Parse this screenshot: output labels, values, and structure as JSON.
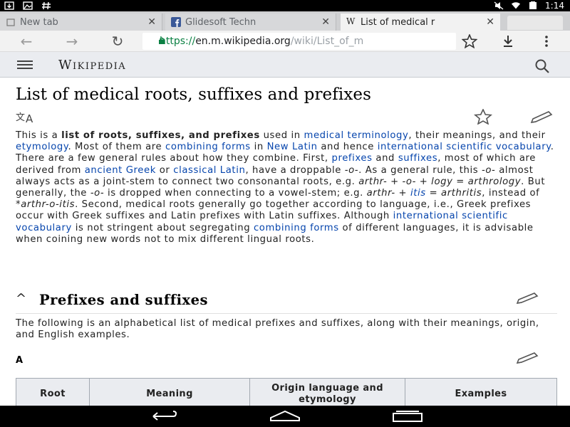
{
  "status_bar": {
    "time": "1:14",
    "icons_left": [
      "download-icon",
      "photo-icon",
      "hash-icon"
    ],
    "icons_right": [
      "mute-icon",
      "wifi-icon",
      "battery-icon"
    ]
  },
  "tabs": [
    {
      "label": "New tab",
      "favicon": "chrome-icon"
    },
    {
      "label": "Glidesoft Techn",
      "favicon": "facebook-icon"
    },
    {
      "label": "List of medical r",
      "favicon": "wikipedia-icon",
      "active": true
    }
  ],
  "toolbar": {
    "url_protocol": "https://",
    "url_host": "en.m.wikipedia.org",
    "url_path": "/wiki/List_of_m"
  },
  "wiki": {
    "logo_text": "Wikipedia"
  },
  "article": {
    "title": "List of medical roots, suffixes and prefixes",
    "intro": {
      "p1": "This is a ",
      "bold1": "list of roots, suffixes, and prefixes",
      "p2": " used in ",
      "link_medical_terminology": "medical terminology",
      "p3": ", their meanings, and their ",
      "link_etymology": "etymology",
      "p4": ". Most of them are ",
      "link_combining_forms": "combining forms",
      "p5": " in ",
      "link_new_latin": "New Latin",
      "p6": " and hence ",
      "link_isv": "international scientific vocabulary",
      "p7": ". There are a few general rules about how they combine. First, ",
      "link_prefixes": "prefixes",
      "p8": " and ",
      "link_suffixes": "suffixes",
      "p9": ", most of which are derived from ",
      "link_ancient_greek": "ancient Greek",
      "p10": " or ",
      "link_classical_latin": "classical Latin",
      "p11": ", have a droppable ",
      "i1": "-o-",
      "p12": ". As a general rule, this ",
      "i2": "-o-",
      "p13": " almost always acts as a joint-stem to connect two consonantal roots, e.g. ",
      "i3": "arthr- + -o- + logy = arthrology",
      "p14": ". But generally, the ",
      "i4": "-o-",
      "p15": " is dropped when connecting to a vowel-stem; e.g. ",
      "i5": "arthr- + ",
      "link_itis": "itis",
      "i6": " = arthritis",
      "p16": ", instead of ",
      "i7": "*arthr-o-itis",
      "p17": ". Second, medical roots generally go together according to language, i.e., Greek prefixes occur with Greek suffixes and Latin prefixes with Latin suffixes. Although ",
      "link_isv2": "international scientific vocabulary",
      "p18": " is not stringent about segregating ",
      "link_combining_forms2": "combining forms",
      "p19": " of different languages, it is advisable when coining new words not to mix different lingual roots."
    },
    "section_title": "Prefixes and suffixes",
    "section_intro": "The following is an alphabetical list of medical prefixes and suffixes, along with their meanings, origin, and English examples.",
    "subsection": "A",
    "table_headers": [
      "Root",
      "Meaning",
      "Origin language and etymology",
      "Examples"
    ]
  },
  "colors": {
    "link": "#0645ad",
    "url_green": "#0b8043",
    "header_bg": "#eaecf0"
  }
}
